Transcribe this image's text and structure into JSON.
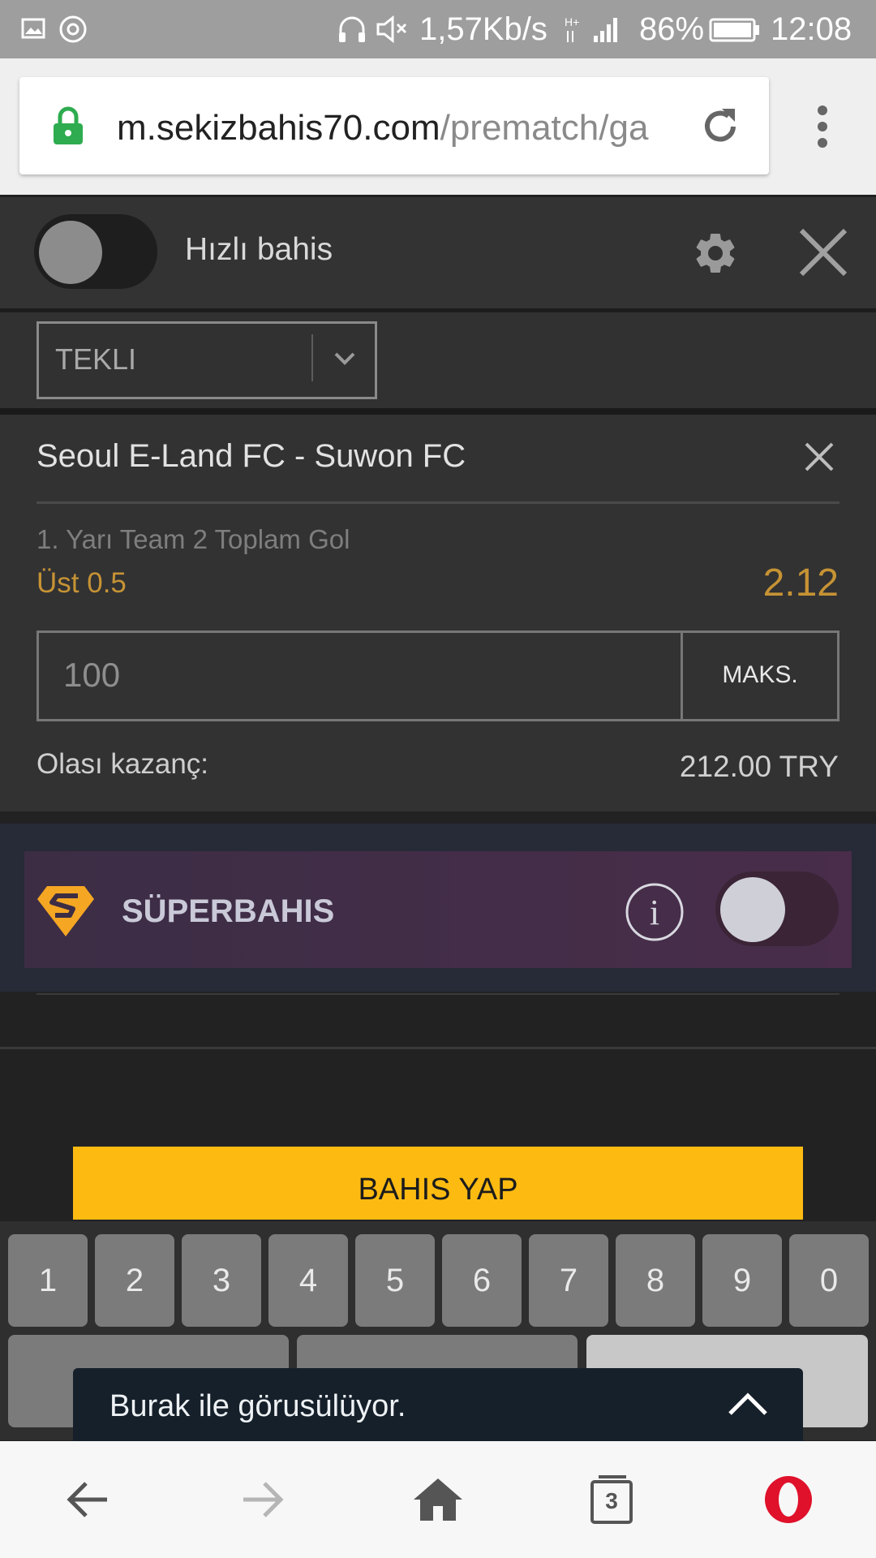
{
  "status_bar": {
    "speed": "1,57Kb/s",
    "battery": "86%",
    "time": "12:08"
  },
  "browser": {
    "url_host": "m.sekizbahis70.com",
    "url_path": "/prematch/ga",
    "tab_count": "3"
  },
  "betslip": {
    "quick_bet_label": "Hızlı bahis",
    "bet_type": "TEKLI",
    "match": "Seoul E-Land FC - Suwon FC",
    "market": "1. Yarı Team 2 Toplam Gol",
    "selection": "Üst 0.5",
    "odds": "2.12",
    "stake": "100",
    "max_label": "MAKS.",
    "possible_win_label": "Olası kazanç:",
    "possible_win_value": "212.00 TRY",
    "superbet_label": "SÜPERBAHIS",
    "place_bet_label": "BAHIS YAP"
  },
  "keyboard": {
    "digits": [
      "1",
      "2",
      "3",
      "4",
      "5",
      "6",
      "7",
      "8",
      "9",
      "0"
    ]
  },
  "toast": {
    "text": "Burak ile görusülüyor."
  },
  "colors": {
    "accent_gold": "#c69334",
    "button_yellow": "#fdbb11",
    "opera_red": "#e0112b"
  }
}
